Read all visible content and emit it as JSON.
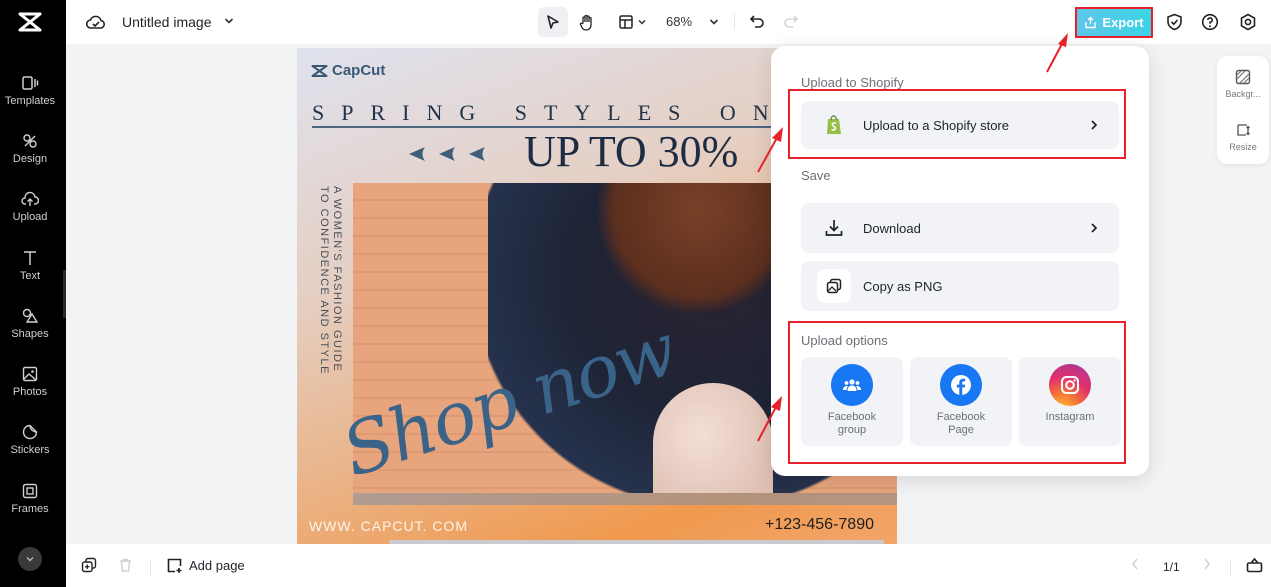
{
  "app": {
    "document_title": "Untitled image",
    "zoom_level": "68%"
  },
  "sidebar": {
    "items": [
      {
        "label": "Templates",
        "icon": "templates-icon"
      },
      {
        "label": "Design",
        "icon": "design-icon"
      },
      {
        "label": "Upload",
        "icon": "upload-icon"
      },
      {
        "label": "Text",
        "icon": "text-icon"
      },
      {
        "label": "Shapes",
        "icon": "shapes-icon"
      },
      {
        "label": "Photos",
        "icon": "photos-icon"
      },
      {
        "label": "Stickers",
        "icon": "stickers-icon"
      },
      {
        "label": "Frames",
        "icon": "frames-icon"
      }
    ]
  },
  "toolbar": {
    "export_label": "Export"
  },
  "right_panel": {
    "items": [
      {
        "label": "Backgr...",
        "icon": "background-icon"
      },
      {
        "label": "Resize",
        "icon": "resize-icon"
      }
    ]
  },
  "canvas": {
    "brand": "CapCut",
    "headline_top": "SPRING STYLES ON",
    "headline_main": "UP TO 30%",
    "vertical_text": "A WOMEN'S FASHION GUIDE TO CONFIDENCE AND STYLE",
    "script_text": "Shop now",
    "website": "WWW. CAPCUT. COM",
    "phone": "+123-456-7890"
  },
  "export_menu": {
    "shopify_section": "Upload to Shopify",
    "shopify_button": "Upload to a Shopify store",
    "save_section": "Save",
    "download_button": "Download",
    "copy_button": "Copy as PNG",
    "upload_section": "Upload options",
    "options": [
      {
        "label": "Facebook group",
        "color": "#1877f2"
      },
      {
        "label": "Facebook Page",
        "color": "#1877f2"
      },
      {
        "label": "Instagram",
        "color": "#e1306c"
      }
    ]
  },
  "bottombar": {
    "add_page_label": "Add page",
    "page_indicator": "1/1"
  },
  "colors": {
    "accent_red": "#e8202a",
    "export_cyan": "#3cd3e6",
    "shopify_green": "#95bf47",
    "facebook_blue": "#1877f2"
  }
}
